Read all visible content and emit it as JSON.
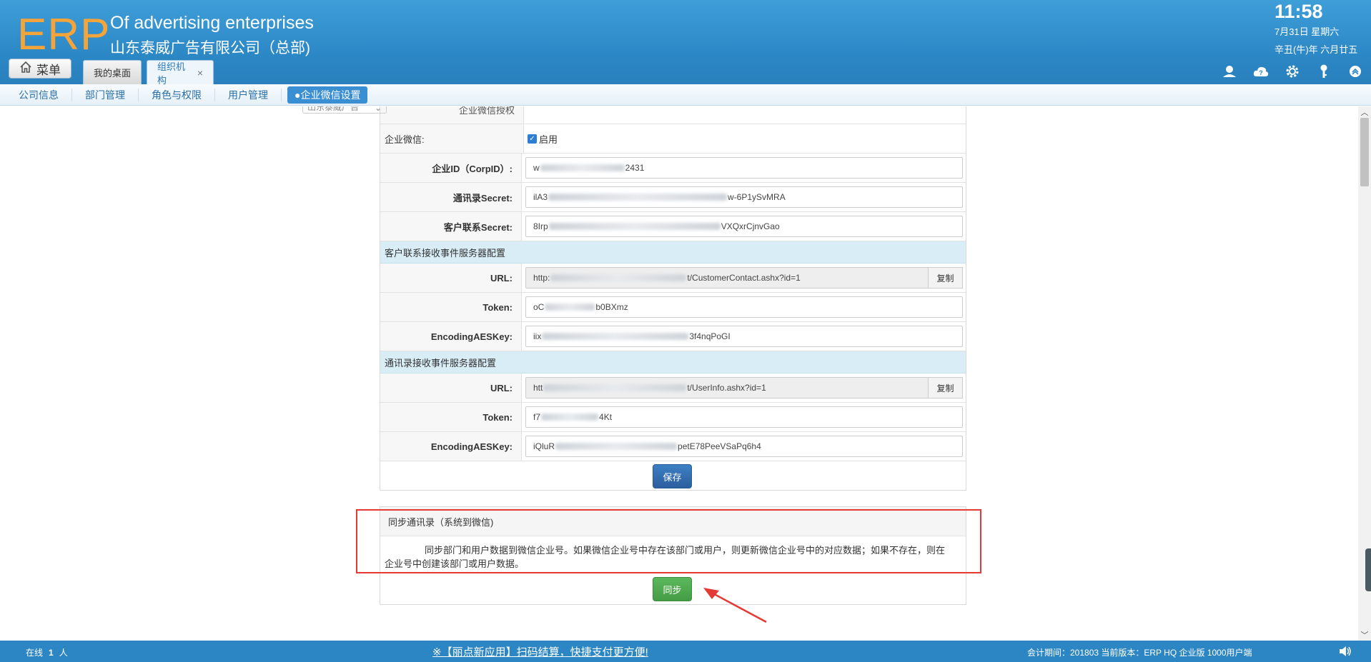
{
  "header": {
    "logo": "ERP",
    "company_en": "Of advertising enterprises",
    "company_cn": "山东泰威广告有限公司（总部)",
    "time": "11:58",
    "date_line1": "7月31日 星期六",
    "date_line2": "辛丑(牛)年 六月廿五",
    "menu_label": "菜单",
    "tabs": [
      {
        "label": "我的桌面"
      },
      {
        "label": "组织机构",
        "close": "×"
      }
    ],
    "icons": [
      "user-icon",
      "cloud-help-icon",
      "gear-icon",
      "key-icon",
      "collapse-up-icon"
    ]
  },
  "subnav": {
    "items": [
      "公司信息",
      "部门管理",
      "角色与权限",
      "用户管理"
    ],
    "active": "●企业微信设置"
  },
  "form": {
    "top_partial_label": "企业微信授权",
    "top_partial_select": "山东泰威广告",
    "wechat_label": "企业微信:",
    "wechat_checkbox_label": "启用",
    "corpid_label": "企业ID（CorpID）:",
    "corpid_prefix": "w",
    "corpid_suffix": "2431",
    "contacts_secret_label": "通讯录Secret:",
    "contacts_secret_prefix": "ilA3",
    "contacts_secret_suffix": "w-6P1ySvMRA",
    "customer_secret_label": "客户联系Secret:",
    "customer_secret_prefix": "8Irp",
    "customer_secret_suffix": "VXQxrCjnvGao",
    "customer_section": "客户联系接收事件服务器配置",
    "url_label": "URL:",
    "customer_url_prefix": "http:",
    "customer_url_suffix": "t/CustomerContact.ashx?id=1",
    "copy_label": "复制",
    "token_label": "Token:",
    "customer_token_prefix": "oC",
    "customer_token_suffix": "b0BXmz",
    "aes_label": "EncodingAESKey:",
    "customer_aes_prefix": "iix",
    "customer_aes_suffix": "3f4nqPoGI",
    "contacts_section": "通讯录接收事件服务器配置",
    "contacts_url_prefix": "htt",
    "contacts_url_suffix": "t/UserInfo.ashx?id=1",
    "contacts_token_prefix": "f7",
    "contacts_token_suffix": "4Kt",
    "contacts_aes_prefix": "iQluR",
    "contacts_aes_suffix": "petE78PeeVSaPq6h4",
    "save_label": "保存"
  },
  "sync": {
    "title": "同步通讯录（系统到微信)",
    "description": "同步部门和用户数据到微信企业号。如果微信企业号中存在该部门或用户，则更新微信企业号中的对应数据；如果不存在，则在企业号中创建该部门或用户数据。",
    "button_label": "同步"
  },
  "footer": {
    "online_label": "在线",
    "online_count": "1",
    "online_unit": "人",
    "promo": "※【丽点新应用】扫码结算，快捷支付更方便!",
    "version": "会计期间：201803  当前版本：ERP HQ 企业版 1000用户端"
  },
  "colors": {
    "header_blue": "#2b86c4",
    "logo_orange": "#f5a43a",
    "save_blue": "#2c5f9e",
    "sync_green": "#449d44",
    "highlight_red": "#e53935"
  }
}
